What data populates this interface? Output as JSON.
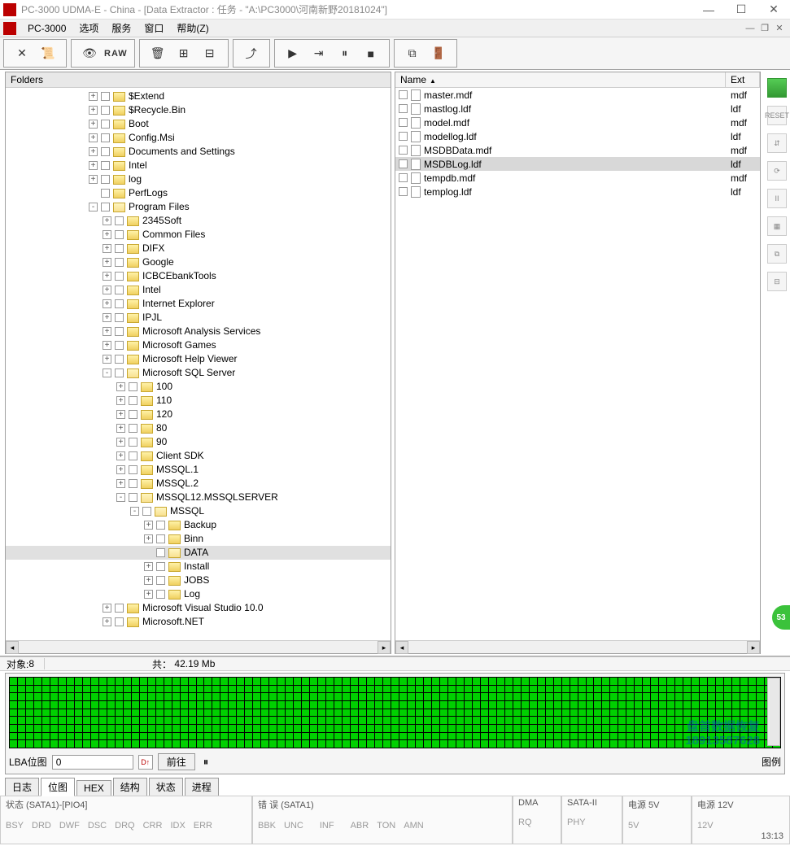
{
  "title": "PC-3000 UDMA-E - China - [Data Extractor : 任务 - \"A:\\PC3000\\河南新野20181024\"]",
  "menu": {
    "app": "PC-3000",
    "items": [
      "选项",
      "服务",
      "窗口",
      "帮助(Z)"
    ]
  },
  "folders_label": "Folders",
  "toolbar": {
    "raw": "RAW"
  },
  "tree": [
    {
      "d": 6,
      "tw": "+",
      "label": "$Extend"
    },
    {
      "d": 6,
      "tw": "+",
      "label": "$Recycle.Bin"
    },
    {
      "d": 6,
      "tw": "+",
      "label": "Boot"
    },
    {
      "d": 6,
      "tw": "+",
      "label": "Config.Msi"
    },
    {
      "d": 6,
      "tw": "+",
      "label": "Documents and Settings"
    },
    {
      "d": 6,
      "tw": "+",
      "label": "Intel"
    },
    {
      "d": 6,
      "tw": "+",
      "label": "log"
    },
    {
      "d": 6,
      "tw": "",
      "label": "PerfLogs"
    },
    {
      "d": 6,
      "tw": "-",
      "label": "Program Files",
      "open": true
    },
    {
      "d": 7,
      "tw": "+",
      "label": "2345Soft"
    },
    {
      "d": 7,
      "tw": "+",
      "label": "Common Files"
    },
    {
      "d": 7,
      "tw": "+",
      "label": "DIFX"
    },
    {
      "d": 7,
      "tw": "+",
      "label": "Google"
    },
    {
      "d": 7,
      "tw": "+",
      "label": "ICBCEbankTools"
    },
    {
      "d": 7,
      "tw": "+",
      "label": "Intel"
    },
    {
      "d": 7,
      "tw": "+",
      "label": "Internet Explorer"
    },
    {
      "d": 7,
      "tw": "+",
      "label": "IPJL"
    },
    {
      "d": 7,
      "tw": "+",
      "label": "Microsoft Analysis Services"
    },
    {
      "d": 7,
      "tw": "+",
      "label": "Microsoft Games"
    },
    {
      "d": 7,
      "tw": "+",
      "label": "Microsoft Help Viewer"
    },
    {
      "d": 7,
      "tw": "-",
      "label": "Microsoft SQL Server",
      "open": true
    },
    {
      "d": 8,
      "tw": "+",
      "label": "100"
    },
    {
      "d": 8,
      "tw": "+",
      "label": "110"
    },
    {
      "d": 8,
      "tw": "+",
      "label": "120"
    },
    {
      "d": 8,
      "tw": "+",
      "label": "80"
    },
    {
      "d": 8,
      "tw": "+",
      "label": "90"
    },
    {
      "d": 8,
      "tw": "+",
      "label": "Client SDK"
    },
    {
      "d": 8,
      "tw": "+",
      "label": "MSSQL.1"
    },
    {
      "d": 8,
      "tw": "+",
      "label": "MSSQL.2"
    },
    {
      "d": 8,
      "tw": "-",
      "label": "MSSQL12.MSSQLSERVER",
      "open": true
    },
    {
      "d": 9,
      "tw": "-",
      "label": "MSSQL",
      "open": true
    },
    {
      "d": 10,
      "tw": "+",
      "label": "Backup"
    },
    {
      "d": 10,
      "tw": "+",
      "label": "Binn"
    },
    {
      "d": 10,
      "tw": "",
      "label": "DATA",
      "sel": true,
      "open": true
    },
    {
      "d": 10,
      "tw": "+",
      "label": "Install"
    },
    {
      "d": 10,
      "tw": "+",
      "label": "JOBS"
    },
    {
      "d": 10,
      "tw": "+",
      "label": "Log"
    },
    {
      "d": 7,
      "tw": "+",
      "label": "Microsoft Visual Studio 10.0"
    },
    {
      "d": 7,
      "tw": "+",
      "label": "Microsoft.NET"
    }
  ],
  "list": {
    "cols": {
      "name": "Name",
      "ext": "Ext"
    },
    "sort_indicator": "▲",
    "rows": [
      {
        "name": "master.mdf",
        "ext": "mdf"
      },
      {
        "name": "mastlog.ldf",
        "ext": "ldf"
      },
      {
        "name": "model.mdf",
        "ext": "mdf"
      },
      {
        "name": "modellog.ldf",
        "ext": "ldf"
      },
      {
        "name": "MSDBData.mdf",
        "ext": "mdf"
      },
      {
        "name": "MSDBLog.ldf",
        "ext": "ldf",
        "sel": true
      },
      {
        "name": "tempdb.mdf",
        "ext": "mdf"
      },
      {
        "name": "templog.ldf",
        "ext": "ldf"
      }
    ]
  },
  "status": {
    "objects_label": "对象:",
    "objects_value": "8",
    "total_label": "共：",
    "total_value": "42.19 Mb"
  },
  "map": {
    "lba_label": "LBA位图",
    "lba_value": "0",
    "go_btn": "前往",
    "legend_btn": "图例"
  },
  "watermark": {
    "line1": "盘首数据恢复",
    "line2": "18913587628"
  },
  "tabs": [
    "日志",
    "位图",
    "HEX",
    "结构",
    "状态",
    "进程"
  ],
  "active_tab": 1,
  "bottom": {
    "g1_label": "状态 (SATA1)-[PIO4]",
    "g1_items": [
      "BSY",
      "DRD",
      "DWF",
      "DSC",
      "DRQ",
      "CRR",
      "IDX",
      "ERR"
    ],
    "g2_label": "错 误 (SATA1)",
    "g2_items": [
      "BBK",
      "UNC",
      "",
      "INF",
      "",
      "ABR",
      "TON",
      "AMN"
    ],
    "g3_label": "DMA",
    "g3_items": [
      "RQ"
    ],
    "g4_label": "SATA-II",
    "g4_items": [
      "PHY"
    ],
    "g5_label": "电源 5V",
    "g5_items": [
      "5V"
    ],
    "g6_label": "电源 12V",
    "g6_items": [
      "12V"
    ]
  },
  "side_labels": [
    "",
    "RESET",
    "",
    "",
    "II",
    "",
    ""
  ],
  "green_badge": "53",
  "clock": "13:13"
}
